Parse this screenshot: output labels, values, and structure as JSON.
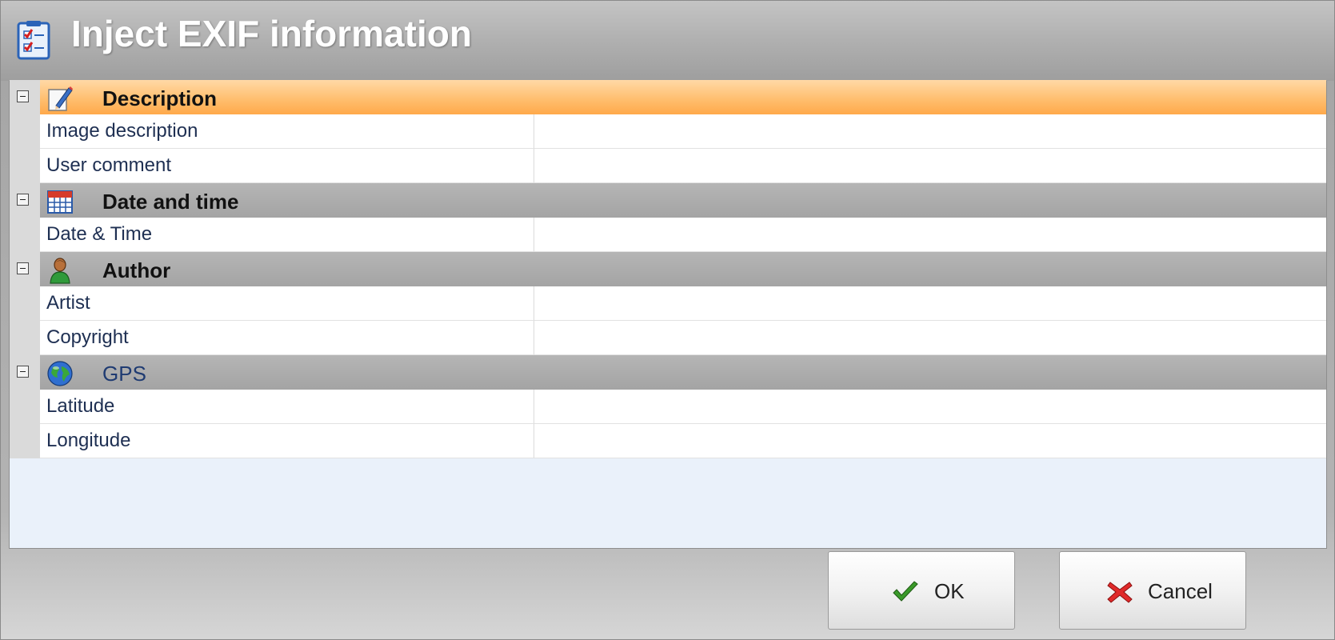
{
  "window": {
    "title": "Inject EXIF information",
    "icon": "checklist-icon"
  },
  "grid": {
    "categories": [
      {
        "label": "Description",
        "icon": "pencil-icon",
        "expanded": true,
        "properties": [
          {
            "name": "Image description",
            "value": ""
          },
          {
            "name": "User comment",
            "value": ""
          }
        ]
      },
      {
        "label": "Date and time",
        "icon": "calendar-icon",
        "expanded": true,
        "properties": [
          {
            "name": "Date & Time",
            "value": ""
          }
        ]
      },
      {
        "label": "Author",
        "icon": "user-icon",
        "expanded": true,
        "properties": [
          {
            "name": "Artist",
            "value": ""
          },
          {
            "name": "Copyright",
            "value": ""
          }
        ]
      },
      {
        "label": "GPS",
        "icon": "globe-icon",
        "expanded": true,
        "properties": [
          {
            "name": "Latitude",
            "value": ""
          },
          {
            "name": "Longitude",
            "value": ""
          }
        ]
      }
    ]
  },
  "buttons": {
    "ok_label": "OK",
    "ok_icon": "checkmark-icon",
    "cancel_label": "Cancel",
    "cancel_icon": "cross-icon"
  },
  "colors": {
    "selected_category": "#ffbf70",
    "category": "#a9a9a9",
    "property_text": "#1e2f52"
  }
}
